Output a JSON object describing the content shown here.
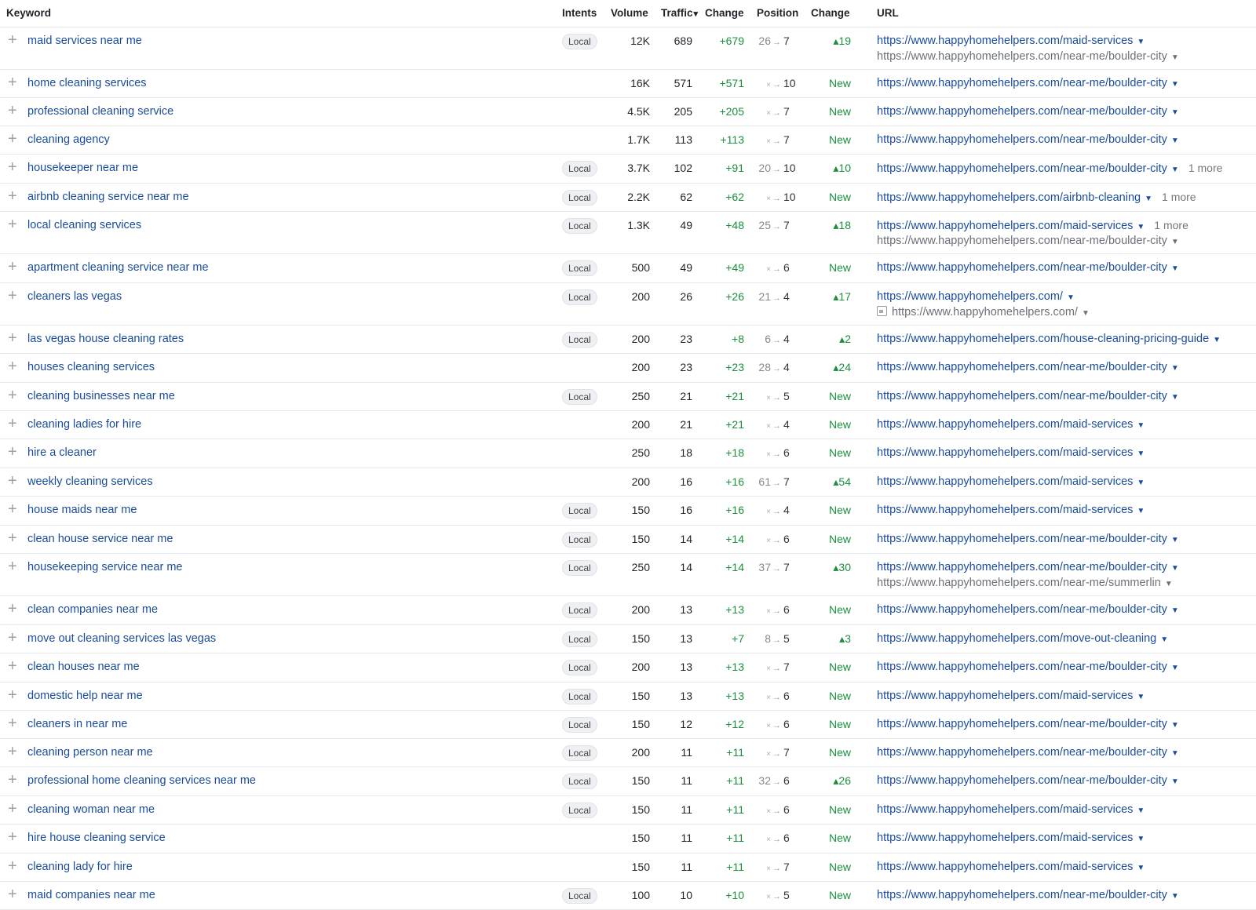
{
  "header": {
    "keyword": "Keyword",
    "intents": "Intents",
    "volume": "Volume",
    "traffic": "Traffic",
    "traffic_sort": "▾",
    "change": "Change",
    "position": "Position",
    "pos_change": "Change",
    "url": "URL"
  },
  "rows": [
    {
      "kw": "maid services near me",
      "intent": "Local",
      "vol": "12K",
      "traf": "689",
      "chg": "+679",
      "from": "26",
      "to": "7",
      "pch": "▴19",
      "url": "https://www.happyhomehelpers.com/maid-services",
      "url2": "https://www.happyhomehelpers.com/near-me/boulder-city",
      "more": ""
    },
    {
      "kw": "home cleaning services",
      "intent": "",
      "vol": "16K",
      "traf": "571",
      "chg": "+571",
      "from": "",
      "to": "10",
      "pch": "New",
      "url": "https://www.happyhomehelpers.com/near-me/boulder-city",
      "url2": "",
      "more": ""
    },
    {
      "kw": "professional cleaning service",
      "intent": "",
      "vol": "4.5K",
      "traf": "205",
      "chg": "+205",
      "from": "",
      "to": "7",
      "pch": "New",
      "url": "https://www.happyhomehelpers.com/near-me/boulder-city",
      "url2": "",
      "more": ""
    },
    {
      "kw": "cleaning agency",
      "intent": "",
      "vol": "1.7K",
      "traf": "113",
      "chg": "+113",
      "from": "",
      "to": "7",
      "pch": "New",
      "url": "https://www.happyhomehelpers.com/near-me/boulder-city",
      "url2": "",
      "more": ""
    },
    {
      "kw": "housekeeper near me",
      "intent": "Local",
      "vol": "3.7K",
      "traf": "102",
      "chg": "+91",
      "from": "20",
      "to": "10",
      "pch": "▴10",
      "url": "https://www.happyhomehelpers.com/near-me/boulder-city",
      "url2": "",
      "more": "1 more"
    },
    {
      "kw": "airbnb cleaning service near me",
      "intent": "Local",
      "vol": "2.2K",
      "traf": "62",
      "chg": "+62",
      "from": "",
      "to": "10",
      "pch": "New",
      "url": "https://www.happyhomehelpers.com/airbnb-cleaning",
      "url2": "",
      "more": "1 more"
    },
    {
      "kw": "local cleaning services",
      "intent": "Local",
      "vol": "1.3K",
      "traf": "49",
      "chg": "+48",
      "from": "25",
      "to": "7",
      "pch": "▴18",
      "url": "https://www.happyhomehelpers.com/maid-services",
      "url2": "https://www.happyhomehelpers.com/near-me/boulder-city",
      "more": "1 more"
    },
    {
      "kw": "apartment cleaning service near me",
      "intent": "Local",
      "vol": "500",
      "traf": "49",
      "chg": "+49",
      "from": "",
      "to": "6",
      "pch": "New",
      "url": "https://www.happyhomehelpers.com/near-me/boulder-city",
      "url2": "",
      "more": ""
    },
    {
      "kw": "cleaners las vegas",
      "intent": "Local",
      "vol": "200",
      "traf": "26",
      "chg": "+26",
      "from": "21",
      "to": "4",
      "pch": "▴17",
      "url": "https://www.happyhomehelpers.com/",
      "url2": "https://www.happyhomehelpers.com/",
      "url2img": true,
      "more": ""
    },
    {
      "kw": "las vegas house cleaning rates",
      "intent": "Local",
      "vol": "200",
      "traf": "23",
      "chg": "+8",
      "from": "6",
      "to": "4",
      "pch": "▴2",
      "url": "https://www.happyhomehelpers.com/house-cleaning-pricing-guide",
      "url2": "",
      "more": ""
    },
    {
      "kw": "houses cleaning services",
      "intent": "",
      "vol": "200",
      "traf": "23",
      "chg": "+23",
      "from": "28",
      "to": "4",
      "pch": "▴24",
      "url": "https://www.happyhomehelpers.com/near-me/boulder-city",
      "url2": "",
      "more": ""
    },
    {
      "kw": "cleaning businesses near me",
      "intent": "Local",
      "vol": "250",
      "traf": "21",
      "chg": "+21",
      "from": "",
      "to": "5",
      "pch": "New",
      "url": "https://www.happyhomehelpers.com/near-me/boulder-city",
      "url2": "",
      "more": ""
    },
    {
      "kw": "cleaning ladies for hire",
      "intent": "",
      "vol": "200",
      "traf": "21",
      "chg": "+21",
      "from": "",
      "to": "4",
      "pch": "New",
      "url": "https://www.happyhomehelpers.com/maid-services",
      "url2": "",
      "more": ""
    },
    {
      "kw": "hire a cleaner",
      "intent": "",
      "vol": "250",
      "traf": "18",
      "chg": "+18",
      "from": "",
      "to": "6",
      "pch": "New",
      "url": "https://www.happyhomehelpers.com/maid-services",
      "url2": "",
      "more": ""
    },
    {
      "kw": "weekly cleaning services",
      "intent": "",
      "vol": "200",
      "traf": "16",
      "chg": "+16",
      "from": "61",
      "to": "7",
      "pch": "▴54",
      "url": "https://www.happyhomehelpers.com/maid-services",
      "url2": "",
      "more": ""
    },
    {
      "kw": "house maids near me",
      "intent": "Local",
      "vol": "150",
      "traf": "16",
      "chg": "+16",
      "from": "",
      "to": "4",
      "pch": "New",
      "url": "https://www.happyhomehelpers.com/maid-services",
      "url2": "",
      "more": ""
    },
    {
      "kw": "clean house service near me",
      "intent": "Local",
      "vol": "150",
      "traf": "14",
      "chg": "+14",
      "from": "",
      "to": "6",
      "pch": "New",
      "url": "https://www.happyhomehelpers.com/near-me/boulder-city",
      "url2": "",
      "more": ""
    },
    {
      "kw": "housekeeping service near me",
      "intent": "Local",
      "vol": "250",
      "traf": "14",
      "chg": "+14",
      "from": "37",
      "to": "7",
      "pch": "▴30",
      "url": "https://www.happyhomehelpers.com/near-me/boulder-city",
      "url2": "https://www.happyhomehelpers.com/near-me/summerlin",
      "more": ""
    },
    {
      "kw": "clean companies near me",
      "intent": "Local",
      "vol": "200",
      "traf": "13",
      "chg": "+13",
      "from": "",
      "to": "6",
      "pch": "New",
      "url": "https://www.happyhomehelpers.com/near-me/boulder-city",
      "url2": "",
      "more": ""
    },
    {
      "kw": "move out cleaning services las vegas",
      "intent": "Local",
      "vol": "150",
      "traf": "13",
      "chg": "+7",
      "from": "8",
      "to": "5",
      "pch": "▴3",
      "url": "https://www.happyhomehelpers.com/move-out-cleaning",
      "url2": "",
      "more": ""
    },
    {
      "kw": "clean houses near me",
      "intent": "Local",
      "vol": "200",
      "traf": "13",
      "chg": "+13",
      "from": "",
      "to": "7",
      "pch": "New",
      "url": "https://www.happyhomehelpers.com/near-me/boulder-city",
      "url2": "",
      "more": ""
    },
    {
      "kw": "domestic help near me",
      "intent": "Local",
      "vol": "150",
      "traf": "13",
      "chg": "+13",
      "from": "",
      "to": "6",
      "pch": "New",
      "url": "https://www.happyhomehelpers.com/maid-services",
      "url2": "",
      "more": ""
    },
    {
      "kw": "cleaners in near me",
      "intent": "Local",
      "vol": "150",
      "traf": "12",
      "chg": "+12",
      "from": "",
      "to": "6",
      "pch": "New",
      "url": "https://www.happyhomehelpers.com/near-me/boulder-city",
      "url2": "",
      "more": ""
    },
    {
      "kw": "cleaning person near me",
      "intent": "Local",
      "vol": "200",
      "traf": "11",
      "chg": "+11",
      "from": "",
      "to": "7",
      "pch": "New",
      "url": "https://www.happyhomehelpers.com/near-me/boulder-city",
      "url2": "",
      "more": ""
    },
    {
      "kw": "professional home cleaning services near me",
      "intent": "Local",
      "vol": "150",
      "traf": "11",
      "chg": "+11",
      "from": "32",
      "to": "6",
      "pch": "▴26",
      "url": "https://www.happyhomehelpers.com/near-me/boulder-city",
      "url2": "",
      "more": ""
    },
    {
      "kw": "cleaning woman near me",
      "intent": "Local",
      "vol": "150",
      "traf": "11",
      "chg": "+11",
      "from": "",
      "to": "6",
      "pch": "New",
      "url": "https://www.happyhomehelpers.com/maid-services",
      "url2": "",
      "more": ""
    },
    {
      "kw": "hire house cleaning service",
      "intent": "",
      "vol": "150",
      "traf": "11",
      "chg": "+11",
      "from": "",
      "to": "6",
      "pch": "New",
      "url": "https://www.happyhomehelpers.com/maid-services",
      "url2": "",
      "more": ""
    },
    {
      "kw": "cleaning lady for hire",
      "intent": "",
      "vol": "150",
      "traf": "11",
      "chg": "+11",
      "from": "",
      "to": "7",
      "pch": "New",
      "url": "https://www.happyhomehelpers.com/maid-services",
      "url2": "",
      "more": ""
    },
    {
      "kw": "maid companies near me",
      "intent": "Local",
      "vol": "100",
      "traf": "10",
      "chg": "+10",
      "from": "",
      "to": "5",
      "pch": "New",
      "url": "https://www.happyhomehelpers.com/near-me/boulder-city",
      "url2": "",
      "more": ""
    }
  ],
  "icons": {
    "expand": "plus-icon",
    "dropdown": "caret-down-icon",
    "new_position": "cross-icon",
    "arrow": "arrow-right-icon",
    "up": "triangle-up-icon"
  },
  "colors": {
    "link": "#1a4c9c",
    "positive": "#1a8f3c",
    "badge_bg": "#eef0f3",
    "border": "#e6e8ec"
  }
}
